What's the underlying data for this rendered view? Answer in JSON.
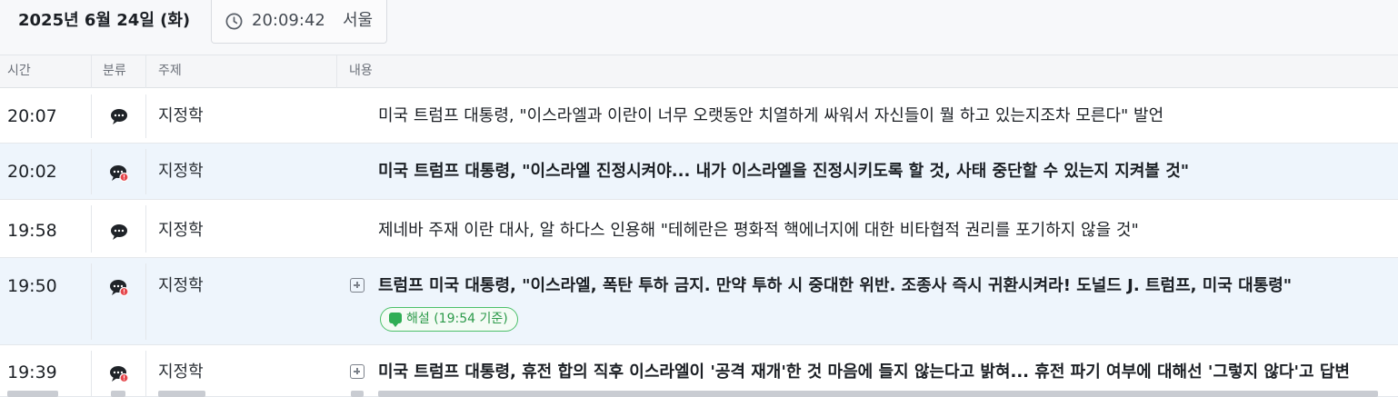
{
  "header": {
    "date": "2025년 6월 24일 (화)",
    "clock_time": "20:09:42",
    "clock_city": "서울",
    "clock_icon": "clock-icon"
  },
  "columns": {
    "time": "시간",
    "category": "분류",
    "topic": "주제",
    "content": "내용"
  },
  "rows": [
    {
      "time": "20:07",
      "category_icon": "speech-bubble-icon",
      "topic": "지정학",
      "content": "미국 트럼프 대통령, \"이스라엘과 이란이 너무 오랫동안 치열하게 싸워서 자신들이 뭘 하고 있는지조차 모른다\" 발언"
    },
    {
      "time": "20:02",
      "category_icon": "speech-bubble-alert-icon",
      "topic": "지정학",
      "content": "미국 트럼프 대통령, \"이스라엘 진정시켜야... 내가 이스라엘을 진정시키도록 할 것, 사태 중단할 수 있는지 지켜볼 것\""
    },
    {
      "time": "19:58",
      "category_icon": "speech-bubble-icon",
      "topic": "지정학",
      "content": "제네바 주재 이란 대사, 알 하다스 인용해 \"테헤란은 평화적 핵에너지에 대한 비타협적 권리를 포기하지 않을 것\""
    },
    {
      "time": "19:50",
      "category_icon": "speech-bubble-alert-icon",
      "topic": "지정학",
      "content": "트럼프 미국 대통령, \"이스라엘, 폭탄 투하 금지. 만약 투하 시 중대한 위반. 조종사 즉시 귀환시켜라! 도널드 J. 트럼프, 미국 대통령\"",
      "badge": "해설 (19:54 기준)"
    },
    {
      "time": "19:39",
      "category_icon": "speech-bubble-alert-icon",
      "topic": "지정학",
      "content": "미국 트럼프 대통령, 휴전 합의 직후 이스라엘이 '공격 재개'한 것 마음에 들지 않는다고 밝혀... 휴전 파기 여부에 대해선 '그렇지 않다'고 답변"
    }
  ],
  "colors": {
    "highlight_row": "#eef5fc",
    "badge_green": "#2c9a4a",
    "alert_red": "#e5484d"
  }
}
